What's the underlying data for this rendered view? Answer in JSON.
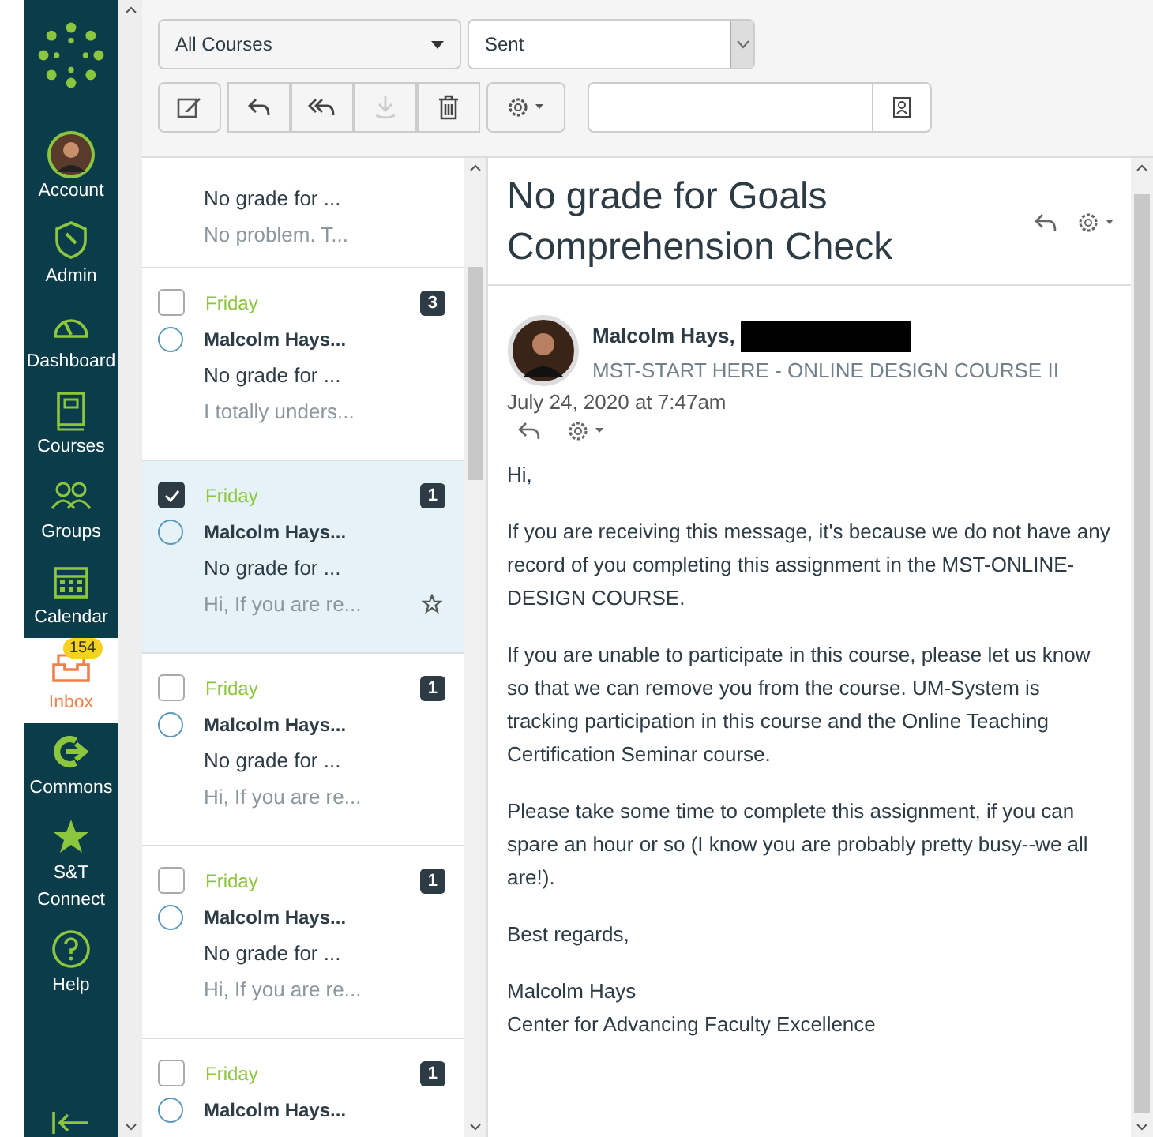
{
  "nav": [
    {
      "kind": "avatar",
      "label": "Account",
      "selected": false
    },
    {
      "kind": "shield",
      "label": "Admin",
      "selected": false
    },
    {
      "kind": "gauge",
      "label": "Dashboard",
      "selected": false
    },
    {
      "kind": "book",
      "label": "Courses",
      "selected": false
    },
    {
      "kind": "people",
      "label": "Groups",
      "selected": false
    },
    {
      "kind": "calendar",
      "label": "Calendar",
      "selected": false
    },
    {
      "kind": "inbox",
      "label": "Inbox",
      "selected": true,
      "badge": "154"
    },
    {
      "kind": "commons",
      "label": "Commons",
      "selected": false
    },
    {
      "kind": "star",
      "label": "S&T Connect",
      "selected": false
    },
    {
      "kind": "help",
      "label": "Help",
      "selected": false
    }
  ],
  "toolbar": {
    "course_filter": "All Courses",
    "folder": "Sent"
  },
  "messages": [
    {
      "subject": "No grade for ...",
      "preview": "No problem. T...",
      "selected": false
    },
    {
      "date": "Friday",
      "count": "3",
      "sender": "Malcolm Hays...",
      "subject": "No grade for ...",
      "preview": "I totally unders...",
      "checked": false,
      "selected": false
    },
    {
      "date": "Friday",
      "count": "1",
      "sender": "Malcolm Hays...",
      "subject": "No grade for ...",
      "preview": "Hi, If you are re...",
      "checked": true,
      "selected": true
    },
    {
      "date": "Friday",
      "count": "1",
      "sender": "Malcolm Hays...",
      "subject": "No grade for ...",
      "preview": "Hi, If you are re...",
      "checked": false,
      "selected": false
    },
    {
      "date": "Friday",
      "count": "1",
      "sender": "Malcolm Hays...",
      "subject": "No grade for ...",
      "preview": "Hi, If you are re...",
      "checked": false,
      "selected": false
    },
    {
      "date": "Friday",
      "count": "1",
      "sender": "Malcolm Hays...",
      "checked": false,
      "selected": false
    }
  ],
  "conversation": {
    "title": "No grade for Goals Comprehension Check",
    "author": "Malcolm Hays,",
    "course": "MST-START HERE - ONLINE DESIGN COURSE II",
    "timestamp": "July 24, 2020 at 7:47am",
    "body": [
      "Hi,",
      "If you are receiving this message, it's because we do not have any record of you completing this assignment in the MST-ONLINE-DESIGN COURSE.",
      "If you are unable to participate in this course, please let us know so that we can remove you from the course. UM-System is tracking participation in this course and the Online Teaching Certification Seminar course.",
      "Please take some time to complete this assignment, if you can spare an hour or so (I know you are probably pretty busy--we all are!).",
      "Best regards,",
      "Malcolm Hays\nCenter for Advancing Faculty Excellence"
    ]
  }
}
